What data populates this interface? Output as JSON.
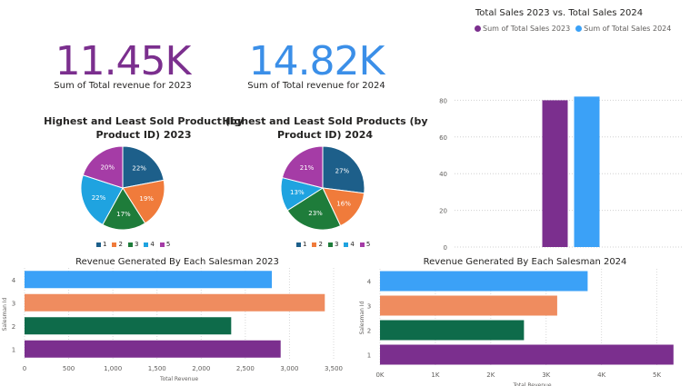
{
  "kpis": [
    {
      "value": "11.45K",
      "label": "Sum of Total revenue for 2023",
      "color": "#7b2f8e"
    },
    {
      "value": "14.82K",
      "label": "Sum of Total revenue for 2024",
      "color": "#3b8fe8"
    }
  ],
  "pies": [
    {
      "title_line1": "Highest and Least Sold Product (by",
      "title_line2": "Product ID) 2023",
      "slices": [
        {
          "label": "22%",
          "value": 22,
          "color": "#1d5f8a"
        },
        {
          "label": "19%",
          "value": 19,
          "color": "#f07b3b"
        },
        {
          "label": "17%",
          "value": 17,
          "color": "#1e7c3a"
        },
        {
          "label": "22%",
          "value": 22,
          "color": "#1fa3e0"
        },
        {
          "label": "20%",
          "value": 20,
          "color": "#a53ca6"
        }
      ],
      "legend": [
        "1",
        "2",
        "3",
        "4",
        "5"
      ]
    },
    {
      "title_line1": "Highest and Least Sold Products (by",
      "title_line2": "Product ID) 2024",
      "slices": [
        {
          "label": "27%",
          "value": 27,
          "color": "#1d5f8a"
        },
        {
          "label": "16%",
          "value": 16,
          "color": "#f07b3b"
        },
        {
          "label": "23%",
          "value": 23,
          "color": "#1e7c3a"
        },
        {
          "label": "13%",
          "value": 13,
          "color": "#1fa3e0"
        },
        {
          "label": "21%",
          "value": 21,
          "color": "#a53ca6"
        }
      ],
      "legend": [
        "1",
        "2",
        "3",
        "4",
        "5"
      ]
    }
  ],
  "chart_data": [
    {
      "type": "bar",
      "title": "Total Sales 2023 vs. Total Sales 2024",
      "series": [
        {
          "name": "Sum of Total Sales 2023",
          "values": [
            80
          ],
          "color": "#7b2f8e"
        },
        {
          "name": "Sum of Total Sales 2024",
          "values": [
            82
          ],
          "color": "#3ba1f7"
        }
      ],
      "yticks": [
        "0",
        "20",
        "40",
        "60",
        "80"
      ],
      "ylim": [
        0,
        100
      ]
    },
    {
      "type": "bar",
      "orientation": "horizontal",
      "title": "Revenue Generated By Each Salesman 2023",
      "xlabel": "Total Revenue",
      "ylabel": "Salesman Id",
      "categories": [
        "1",
        "2",
        "3",
        "4"
      ],
      "values": [
        2900,
        2340,
        3400,
        2800
      ],
      "colors": [
        "#7b2f8e",
        "#0e6b4a",
        "#ef8c5f",
        "#3ba1f7"
      ],
      "xticks": [
        "0",
        "500",
        "1,000",
        "1,500",
        "2,000",
        "2,500",
        "3,000",
        "3,500"
      ],
      "xlim": [
        0,
        3500
      ]
    },
    {
      "type": "bar",
      "orientation": "horizontal",
      "title": "Revenue Generated By Each Salesman 2024",
      "xlabel": "Total Revenue",
      "ylabel": "Salesman Id",
      "categories": [
        "1",
        "2",
        "3",
        "4"
      ],
      "values": [
        5300,
        2600,
        3200,
        3750
      ],
      "colors": [
        "#7b2f8e",
        "#0e6b4a",
        "#ef8c5f",
        "#3ba1f7"
      ],
      "xticks": [
        "0K",
        "1K",
        "2K",
        "3K",
        "4K",
        "5K"
      ],
      "xlim": [
        0,
        5500
      ]
    }
  ]
}
